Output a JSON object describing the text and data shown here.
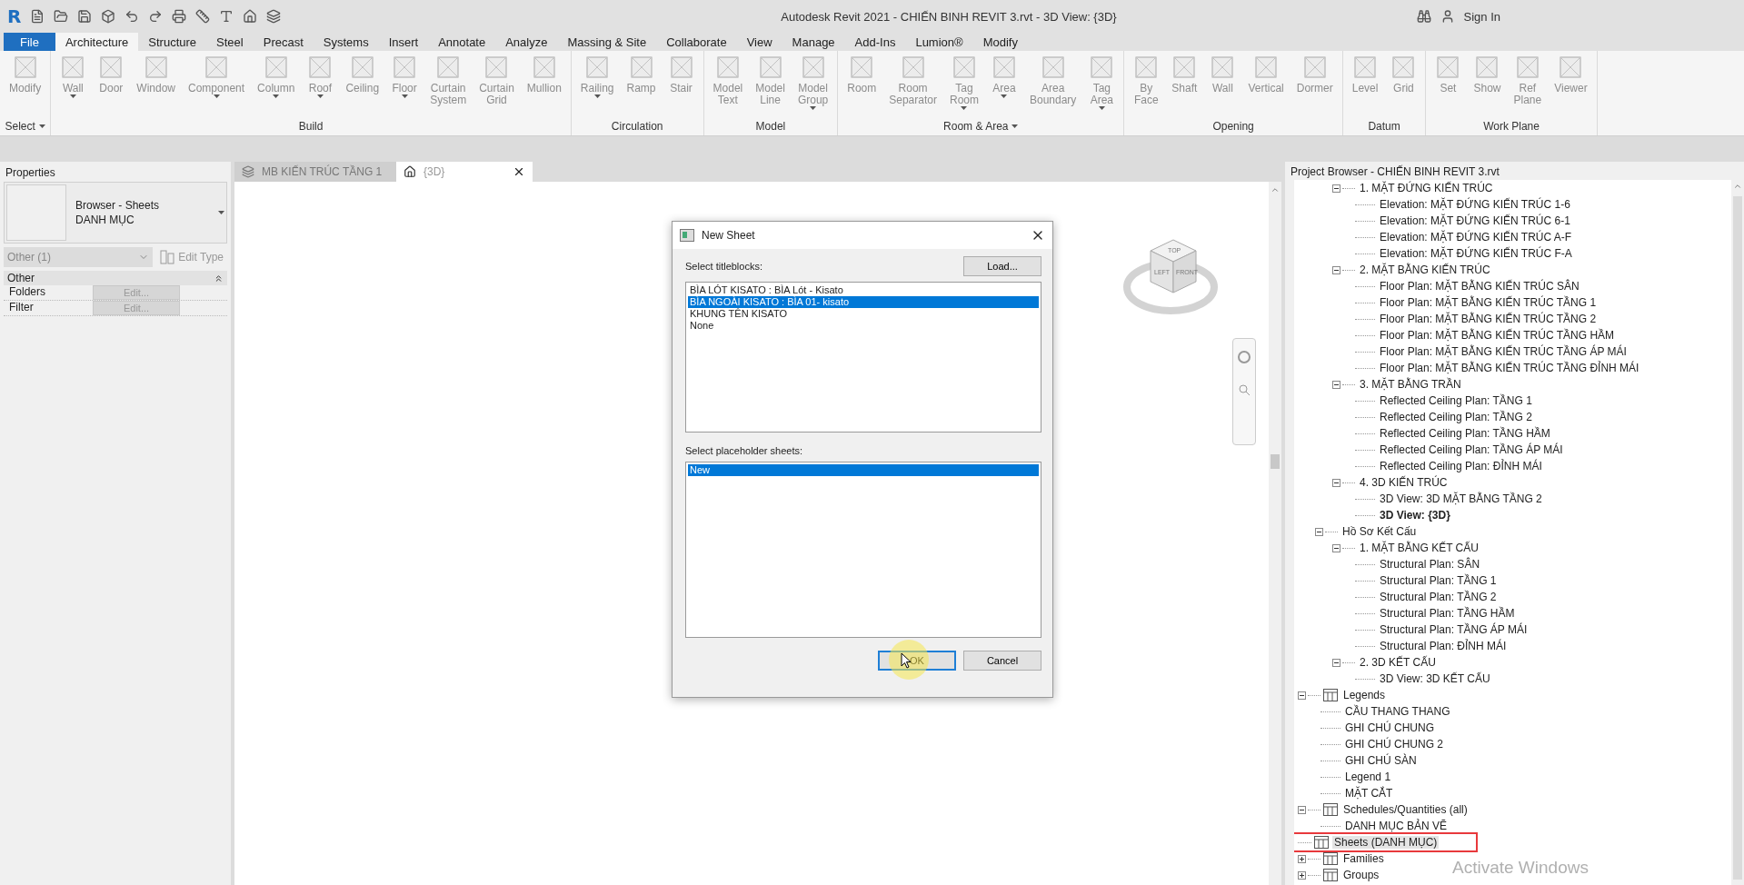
{
  "title_bar": {
    "logo": "R",
    "title": "Autodesk Revit 2021 - CHIẾN BINH REVIT 3.rvt - 3D View: {3D}",
    "sign_in": "Sign In"
  },
  "menu_tabs": [
    {
      "label": "File",
      "kind": "file",
      "selected": false
    },
    {
      "label": "Architecture",
      "kind": "tab",
      "selected": true
    },
    {
      "label": "Structure",
      "kind": "tab",
      "selected": false
    },
    {
      "label": "Steel",
      "kind": "tab",
      "selected": false
    },
    {
      "label": "Precast",
      "kind": "tab",
      "selected": false
    },
    {
      "label": "Systems",
      "kind": "tab",
      "selected": false
    },
    {
      "label": "Insert",
      "kind": "tab",
      "selected": false
    },
    {
      "label": "Annotate",
      "kind": "tab",
      "selected": false
    },
    {
      "label": "Analyze",
      "kind": "tab",
      "selected": false
    },
    {
      "label": "Massing & Site",
      "kind": "tab",
      "selected": false
    },
    {
      "label": "Collaborate",
      "kind": "tab",
      "selected": false
    },
    {
      "label": "View",
      "kind": "tab",
      "selected": false
    },
    {
      "label": "Manage",
      "kind": "tab",
      "selected": false
    },
    {
      "label": "Add-Ins",
      "kind": "tab",
      "selected": false
    },
    {
      "label": "Lumion®",
      "kind": "tab",
      "selected": false
    },
    {
      "label": "Modify",
      "kind": "tab",
      "selected": false
    }
  ],
  "ribbon": [
    {
      "label": "Select",
      "menu": true,
      "tools": [
        {
          "label": "Modify",
          "dropdown": false
        }
      ]
    },
    {
      "label": "Build",
      "menu": false,
      "tools": [
        {
          "label": "Wall",
          "dropdown": true
        },
        {
          "label": "Door",
          "dropdown": false
        },
        {
          "label": "Window",
          "dropdown": false
        },
        {
          "label": "Component",
          "dropdown": true
        },
        {
          "label": "Column",
          "dropdown": true
        },
        {
          "label": "Roof",
          "dropdown": true
        },
        {
          "label": "Ceiling",
          "dropdown": false
        },
        {
          "label": "Floor",
          "dropdown": true
        },
        {
          "label": "Curtain System",
          "dropdown": false
        },
        {
          "label": "Curtain Grid",
          "dropdown": false
        },
        {
          "label": "Mullion",
          "dropdown": false
        }
      ]
    },
    {
      "label": "Circulation",
      "menu": false,
      "tools": [
        {
          "label": "Railing",
          "dropdown": true
        },
        {
          "label": "Ramp",
          "dropdown": false
        },
        {
          "label": "Stair",
          "dropdown": false
        }
      ]
    },
    {
      "label": "Model",
      "menu": false,
      "tools": [
        {
          "label": "Model Text",
          "dropdown": false
        },
        {
          "label": "Model Line",
          "dropdown": false
        },
        {
          "label": "Model Group",
          "dropdown": true
        }
      ]
    },
    {
      "label": "Room & Area",
      "menu": true,
      "tools": [
        {
          "label": "Room",
          "dropdown": false
        },
        {
          "label": "Room Separator",
          "dropdown": false
        },
        {
          "label": "Tag Room",
          "dropdown": true
        },
        {
          "label": "Area",
          "dropdown": true
        },
        {
          "label": "Area Boundary",
          "dropdown": false
        },
        {
          "label": "Tag Area",
          "dropdown": true
        }
      ]
    },
    {
      "label": "Opening",
      "menu": false,
      "tools": [
        {
          "label": "By Face",
          "dropdown": false
        },
        {
          "label": "Shaft",
          "dropdown": false
        },
        {
          "label": "Wall",
          "dropdown": false
        },
        {
          "label": "Vertical",
          "dropdown": false
        },
        {
          "label": "Dormer",
          "dropdown": false
        }
      ]
    },
    {
      "label": "Datum",
      "menu": false,
      "tools": [
        {
          "label": "Level",
          "dropdown": false
        },
        {
          "label": "Grid",
          "dropdown": false
        }
      ]
    },
    {
      "label": "Work Plane",
      "menu": false,
      "tools": [
        {
          "label": "Set",
          "dropdown": false
        },
        {
          "label": "Show",
          "dropdown": false
        },
        {
          "label": "Ref Plane",
          "dropdown": false
        },
        {
          "label": "Viewer",
          "dropdown": false
        }
      ]
    }
  ],
  "properties": {
    "title": "Properties",
    "type_name": "Browser - Sheets",
    "type_value": "DANH MỤC",
    "filter": "Other (1)",
    "edit_type": "Edit Type",
    "category": "Other",
    "rows": [
      {
        "name": "Folders",
        "value": "Edit..."
      },
      {
        "name": "Filter",
        "value": "Edit..."
      }
    ]
  },
  "view_tabs": [
    {
      "label": "MB KIẾN TRÚC TẦNG 1",
      "selected": false
    },
    {
      "label": "{3D}",
      "selected": true
    }
  ],
  "view_cube": {
    "top": "TOP",
    "left": "LEFT",
    "front": "FRONT"
  },
  "dialog": {
    "title": "New Sheet",
    "titleblocks_label": "Select titleblocks:",
    "load": "Load...",
    "titleblocks": [
      {
        "label": "BÌA LÓT KISATO : BÌA Lót - Kisato",
        "selected": false
      },
      {
        "label": "BÌA NGOÀI KISATO : BÌA 01- kisato",
        "selected": true
      },
      {
        "label": "KHUNG TÊN KISATO",
        "selected": false
      },
      {
        "label": "None",
        "selected": false
      }
    ],
    "placeholders_label": "Select placeholder sheets:",
    "placeholders": [
      {
        "label": "New",
        "selected": true
      }
    ],
    "ok": "OK",
    "cancel": "Cancel"
  },
  "browser": {
    "title": "Project Browser - CHIẾN BINH REVIT 3.rvt",
    "tree": [
      {
        "children": [
          {
            "children": [
              {
                "label": "1. MẶT ĐỨNG KIẾN TRÚC",
                "selected": false,
                "expanded": true,
                "children": [
                  {
                    "label": "Elevation: MẶT ĐỨNG KIẾN TRÚC 1-6",
                    "selected": false
                  },
                  {
                    "label": "Elevation: MẶT ĐỨNG KIẾN TRÚC 6-1",
                    "selected": false
                  },
                  {
                    "label": "Elevation: MẶT ĐỨNG KIẾN TRÚC A-F",
                    "selected": false
                  },
                  {
                    "label": "Elevation: MẶT ĐỨNG KIẾN TRÚC F-A",
                    "selected": false
                  }
                ]
              },
              {
                "label": "2. MẶT BẰNG KIẾN TRÚC",
                "selected": false,
                "expanded": true,
                "children": [
                  {
                    "label": "Floor Plan: MẶT BẰNG KIẾN TRÚC SÂN",
                    "selected": false
                  },
                  {
                    "label": "Floor Plan: MẶT BẰNG KIẾN TRÚC TẦNG 1",
                    "selected": false
                  },
                  {
                    "label": "Floor Plan: MẶT BẰNG KIẾN TRÚC TẦNG 2",
                    "selected": false
                  },
                  {
                    "label": "Floor Plan: MẶT BẰNG KIẾN TRÚC TẦNG HẦM",
                    "selected": false
                  },
                  {
                    "label": "Floor Plan: MẶT BẰNG KIẾN TRÚC TẦNG ÁP MÁI",
                    "selected": false
                  },
                  {
                    "label": "Floor Plan: MẶT BẰNG KIẾN TRÚC TẦNG ĐỈNH MÁI",
                    "selected": false
                  }
                ]
              },
              {
                "label": "3. MẶT BẰNG TRẦN",
                "selected": false,
                "expanded": true,
                "children": [
                  {
                    "label": "Reflected Ceiling Plan: TẦNG 1",
                    "selected": false
                  },
                  {
                    "label": "Reflected Ceiling Plan: TẦNG 2",
                    "selected": false
                  },
                  {
                    "label": "Reflected Ceiling Plan: TẦNG HẦM",
                    "selected": false
                  },
                  {
                    "label": "Reflected Ceiling Plan: TẦNG ÁP MÁI",
                    "selected": false
                  },
                  {
                    "label": "Reflected Ceiling Plan: ĐỈNH MÁI",
                    "selected": false
                  }
                ]
              },
              {
                "label": "4. 3D KIẾN TRÚC",
                "selected": false,
                "expanded": true,
                "children": [
                  {
                    "label": "3D View: 3D MẶT BẰNG TẦNG 2",
                    "selected": false
                  },
                  {
                    "label": "3D View: {3D}",
                    "selected": false,
                    "current": true
                  }
                ]
              }
            ]
          },
          {
            "label": "Hồ Sơ Kết Cấu",
            "selected": false,
            "expanded": true,
            "children": [
              {
                "label": "1. MẶT BẰNG KẾT CẤU",
                "selected": false,
                "expanded": true,
                "children": [
                  {
                    "label": "Structural Plan: SÂN",
                    "selected": false
                  },
                  {
                    "label": "Structural Plan: TẦNG 1",
                    "selected": false
                  },
                  {
                    "label": "Structural Plan: TẦNG 2",
                    "selected": false
                  },
                  {
                    "label": "Structural Plan: TẦNG HẦM",
                    "selected": false
                  },
                  {
                    "label": "Structural Plan: TẦNG ÁP MÁI",
                    "selected": false
                  },
                  {
                    "label": "Structural Plan: ĐỈNH MÁI",
                    "selected": false
                  }
                ]
              },
              {
                "label": "2. 3D KẾT CẤU",
                "selected": false,
                "expanded": true,
                "children": [
                  {
                    "label": "3D View: 3D KẾT CẤU",
                    "selected": false
                  }
                ]
              }
            ]
          }
        ]
      },
      {
        "label": "Legends",
        "selected": false,
        "expanded": true,
        "children": [
          {
            "label": "CẦU THANG THANG",
            "selected": false
          },
          {
            "label": "GHI CHÚ CHUNG",
            "selected": false
          },
          {
            "label": "GHI CHÚ CHUNG 2",
            "selected": false
          },
          {
            "label": "GHI CHÚ SÀN",
            "selected": false
          },
          {
            "label": "Legend 1",
            "selected": false
          },
          {
            "label": "MẶT CẮT",
            "selected": false
          }
        ]
      },
      {
        "label": "Schedules/Quantities (all)",
        "selected": false,
        "expanded": true,
        "children": [
          {
            "label": "DANH MỤC BẢN VẼ",
            "selected": false
          }
        ]
      },
      {
        "label": "Sheets (DANH MỤC)",
        "selected": true,
        "outlined": true
      },
      {
        "label": "Families",
        "selected": false,
        "expanded": false
      },
      {
        "label": "Groups",
        "selected": false,
        "expanded": false
      }
    ]
  },
  "os_notice": "Activate Windows"
}
